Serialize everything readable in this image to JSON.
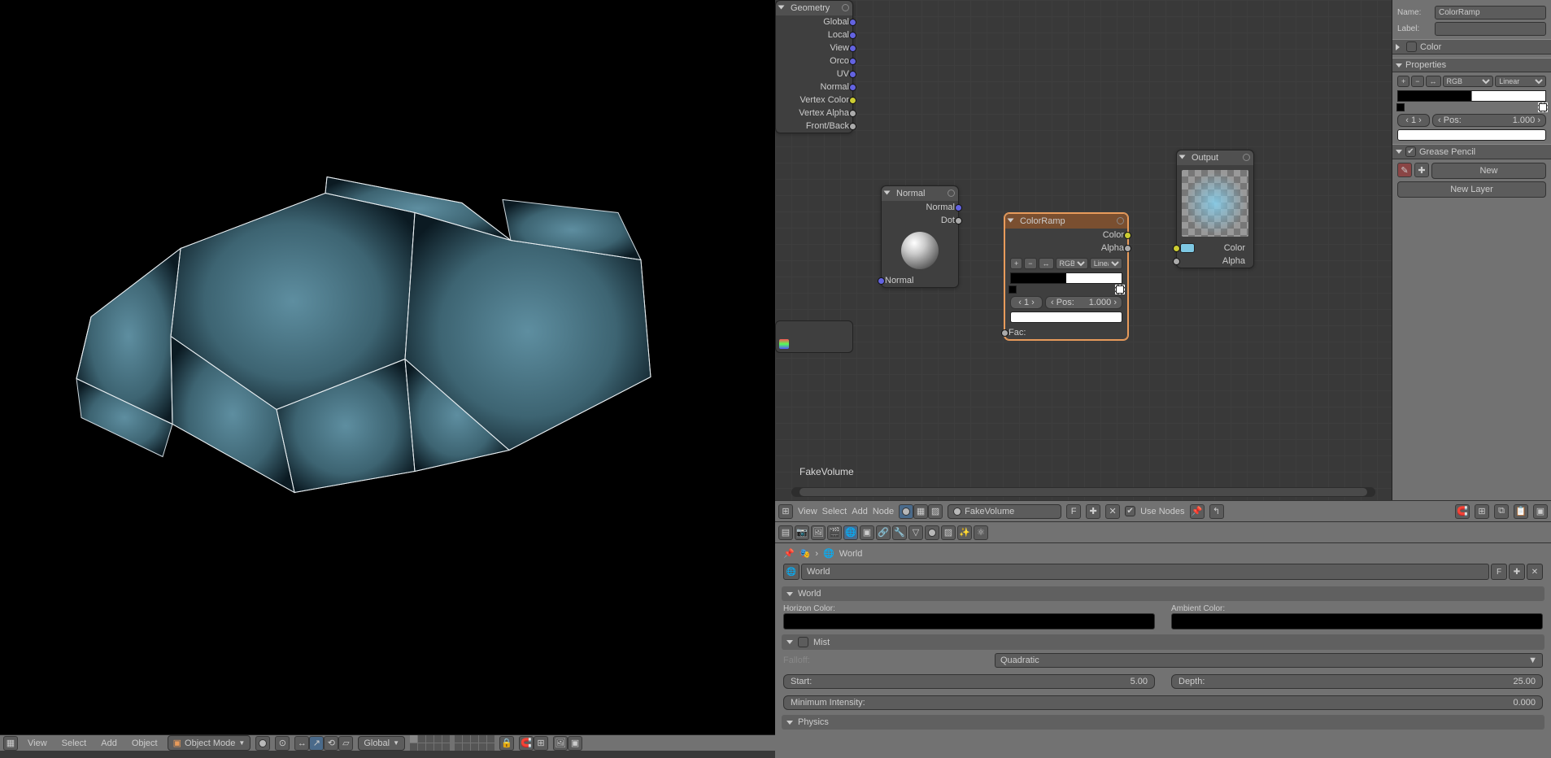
{
  "viewport3d": {
    "menus": [
      "View",
      "Select",
      "Add",
      "Object"
    ],
    "mode": "Object Mode",
    "orientation": "Global"
  },
  "nodeEditor": {
    "material_label": "FakeVolume",
    "menus": [
      "View",
      "Select",
      "Add",
      "Node"
    ],
    "use_nodes": "Use Nodes",
    "material_field": "FakeVolume",
    "f_btn": "F",
    "nodes": {
      "geometry": {
        "title": "Geometry",
        "outputs": [
          "Global",
          "Local",
          "View",
          "Orco",
          "UV",
          "Normal",
          "Vertex Color",
          "Vertex Alpha",
          "Front/Back"
        ]
      },
      "normal": {
        "title": "Normal",
        "out_normal": "Normal",
        "out_dot": "Dot",
        "in_normal": "Normal"
      },
      "colorramp": {
        "title": "ColorRamp",
        "out_color": "Color",
        "out_alpha": "Alpha",
        "in_fac": "Fac:",
        "mode1": "RGB",
        "mode2": "Linear",
        "stop_index": "1",
        "pos_label": "Pos:",
        "pos_value": "1.000"
      },
      "output": {
        "title": "Output",
        "in_color": "Color",
        "in_alpha": "Alpha"
      }
    }
  },
  "sidePanel": {
    "name_label": "Name:",
    "name_value": "ColorRamp",
    "label_label": "Label:",
    "label_value": "",
    "section_color": "Color",
    "section_properties": "Properties",
    "rgb": "RGB",
    "interp": "Linear",
    "stop_index": "1",
    "pos_label": "Pos:",
    "pos_value": "1.000",
    "section_gp": "Grease Pencil",
    "new": "New",
    "new_layer": "New Layer"
  },
  "properties": {
    "breadcrumb": "World",
    "browser_value": "World",
    "f": "F",
    "panel_world": "World",
    "horizon": "Horizon Color:",
    "ambient": "Ambient Color:",
    "panel_mist": "Mist",
    "falloff_label": "Falloff:",
    "falloff_value": "Quadratic",
    "start_label": "Start:",
    "start_value": "5.00",
    "depth_label": "Depth:",
    "depth_value": "25.00",
    "min_int_label": "Minimum Intensity:",
    "min_int_value": "0.000",
    "panel_physics": "Physics"
  }
}
